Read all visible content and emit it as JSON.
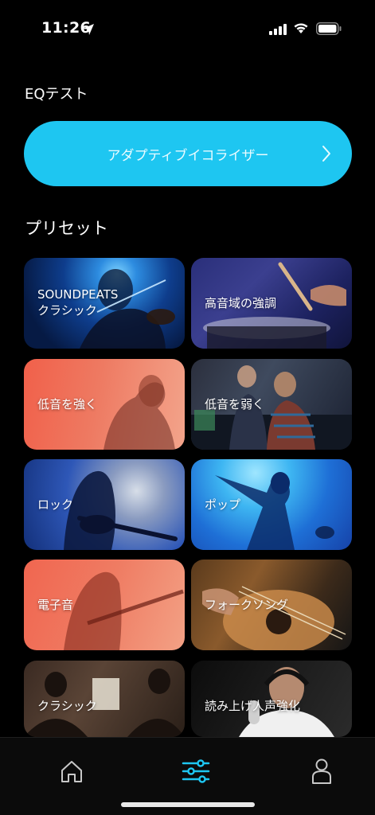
{
  "status_bar": {
    "time": "11:26",
    "location_icon": "location-arrow-icon",
    "signal_icon": "cellular-signal-icon",
    "wifi_icon": "wifi-icon",
    "battery_icon": "battery-icon"
  },
  "eq_test": {
    "title": "EQテスト",
    "adaptive_button_label": "アダプティブイコライザー",
    "chevron_icon": "chevron-right-icon"
  },
  "presets": {
    "title": "プリセット",
    "items": [
      {
        "label": "SOUNDPEATS\nクラシック"
      },
      {
        "label": "高音域の強調"
      },
      {
        "label": "低音を強く"
      },
      {
        "label": "低音を弱く"
      },
      {
        "label": "ロック"
      },
      {
        "label": "ポップ"
      },
      {
        "label": "電子音"
      },
      {
        "label": "フォークソング"
      },
      {
        "label": "クラシック"
      },
      {
        "label": "読み上げ人声強化"
      }
    ]
  },
  "tab_bar": {
    "tabs": [
      {
        "icon": "home-icon",
        "active": false
      },
      {
        "icon": "equalizer-sliders-icon",
        "active": true
      },
      {
        "icon": "profile-icon",
        "active": false
      }
    ],
    "active_color": "#1ec6f1",
    "inactive_color": "#c8c8c8"
  },
  "colors": {
    "accent": "#1ec6f1",
    "background": "#000000"
  }
}
